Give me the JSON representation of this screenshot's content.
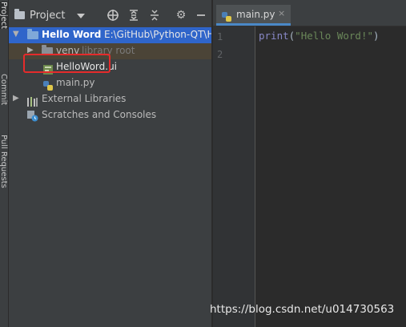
{
  "sidebar_tabs": {
    "project": "Project",
    "commit": "Commit",
    "pull_requests": "Pull Requests"
  },
  "panel": {
    "title": "Project",
    "header_icons": [
      "target-icon",
      "expand-all-icon",
      "collapse-all-icon",
      "gear-icon",
      "minimize-icon"
    ]
  },
  "tree": {
    "root_name": "Hello Word",
    "root_path": "E:\\GitHub\\Python-QT\\H",
    "venv_name": "venv",
    "venv_note": "library root",
    "ui_file": "HelloWord.ui",
    "py_file": "main.py",
    "external_libraries": "External Libraries",
    "scratches": "Scratches and Consoles"
  },
  "editor": {
    "tab_label": "main.py",
    "tab_close": "×",
    "line_numbers": [
      "1",
      "2"
    ],
    "code_func": "print",
    "code_open": "(",
    "code_string": "\"Hello Word!\"",
    "code_close": ")"
  },
  "watermark": "https://blog.csdn.net/u014730563",
  "colors": {
    "highlight_box": "#e52b2b",
    "selection": "#2f65ca",
    "excluded_row": "#4b4437",
    "string": "#6a8759",
    "keyword": "#8888c6"
  }
}
